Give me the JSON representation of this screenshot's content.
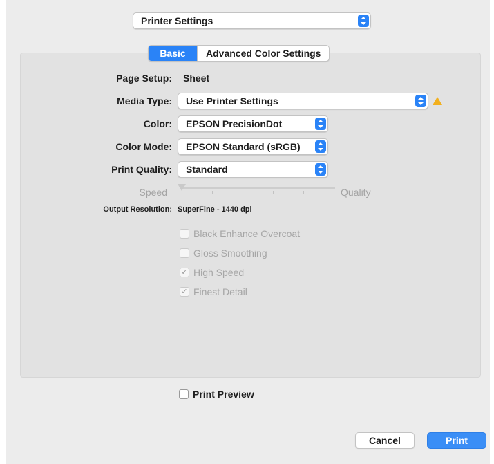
{
  "header": {
    "popup_label": "Printer Settings"
  },
  "tabs": [
    {
      "label": "Basic",
      "active": true
    },
    {
      "label": "Advanced Color Settings",
      "active": false
    }
  ],
  "form": {
    "page_setup": {
      "label": "Page Setup:",
      "value": "Sheet"
    },
    "media_type": {
      "label": "Media Type:",
      "value": "Use Printer Settings",
      "warning_icon": "warning-triangle-icon"
    },
    "color": {
      "label": "Color:",
      "value": "EPSON PrecisionDot"
    },
    "color_mode": {
      "label": "Color Mode:",
      "value": "EPSON Standard (sRGB)"
    },
    "print_quality": {
      "label": "Print Quality:",
      "value": "Standard"
    },
    "slider": {
      "left_label": "Speed",
      "right_label": "Quality",
      "position": 0.0
    },
    "output_resolution": {
      "label": "Output Resolution:",
      "value": "SuperFine - 1440 dpi"
    }
  },
  "options": [
    {
      "label": "Black Enhance Overcoat",
      "checked": false
    },
    {
      "label": "Gloss Smoothing",
      "checked": false
    },
    {
      "label": "High Speed",
      "checked": true
    },
    {
      "label": "Finest Detail",
      "checked": true
    }
  ],
  "print_preview": {
    "label": "Print Preview",
    "checked": false
  },
  "buttons": {
    "cancel": "Cancel",
    "print": "Print"
  },
  "colors": {
    "accent": "#2a83f7",
    "warning": "#f2b01e",
    "background": "#ececec",
    "panel": "#e2e2e2"
  }
}
